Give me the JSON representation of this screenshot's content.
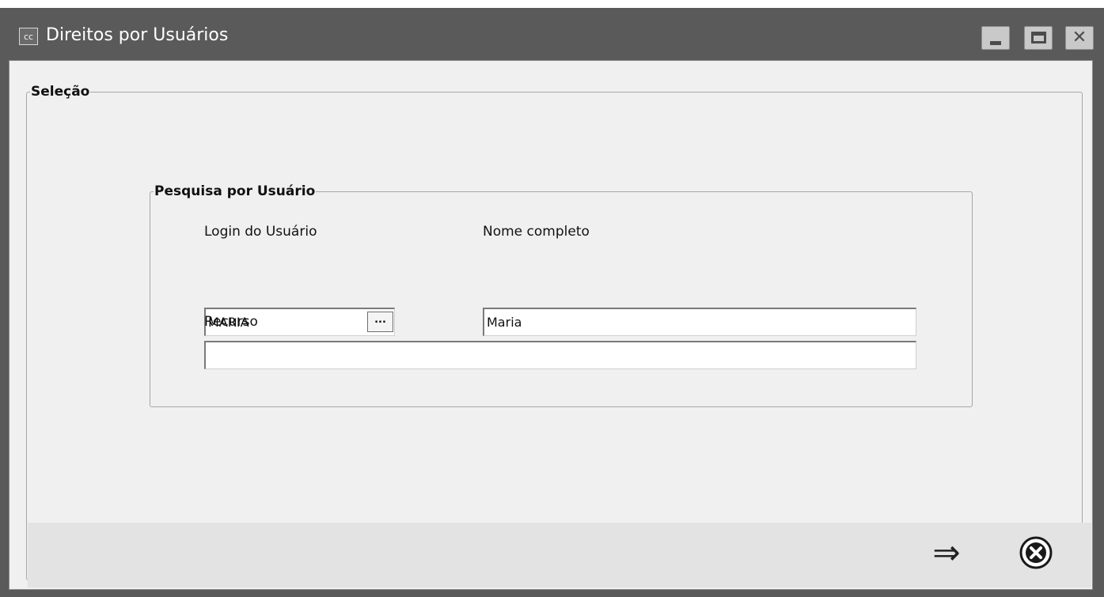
{
  "window": {
    "app_icon_text": "cc",
    "title": "Direitos por Usuários",
    "controls": {
      "minimize": "minimize-icon",
      "maximize": "maximize-icon",
      "close": "close-icon"
    }
  },
  "selecao": {
    "legend": "Seleção",
    "pesquisa": {
      "legend": "Pesquisa por Usuário",
      "login_label": "Login do Usuário",
      "login_value": "MARIA",
      "lookup_button_label": "...",
      "nome_label": "Nome completo",
      "nome_value": "Maria",
      "recurso_label": "Recurso",
      "recurso_value": ""
    }
  },
  "footer": {
    "next_icon": "arrow-right-icon",
    "cancel_icon": "cancel-circle-icon"
  }
}
